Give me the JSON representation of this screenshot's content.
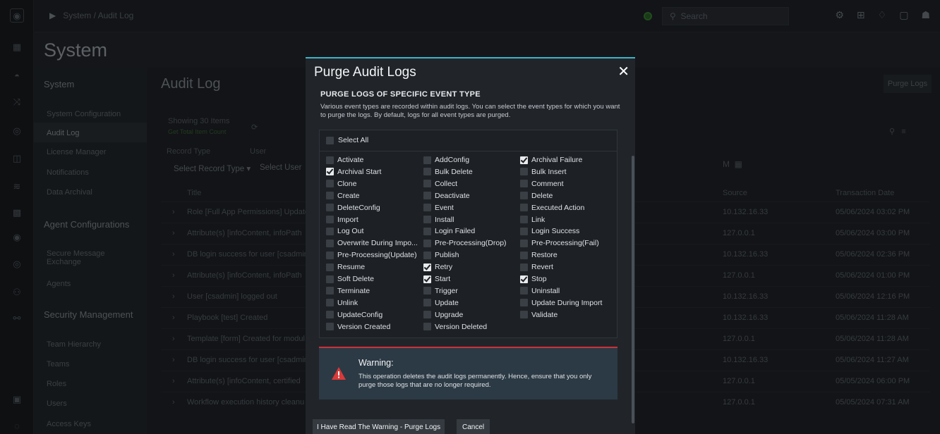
{
  "topbar": {
    "breadcrumb": "System / Audit Log",
    "search_placeholder": "Search"
  },
  "page": {
    "title": "System",
    "section_title": "Audit Log",
    "purge_button": "Purge Logs"
  },
  "leftnav": {
    "system_header": "System",
    "items": [
      "System Configuration",
      "Audit Log",
      "License Manager",
      "Notifications",
      "Data Archival"
    ],
    "agent_header": "Agent Configurations",
    "agent_items": [
      "Secure Message Exchange",
      "Agents"
    ],
    "security_header": "Security Management",
    "security_items": [
      "Team Hierarchy",
      "Teams",
      "Roles",
      "Users",
      "Access Keys"
    ]
  },
  "background": {
    "showing": "Showing 30 Items",
    "get_total": "Get Total Item Count",
    "record_type_label": "Record Type",
    "user_label": "User",
    "record_type_select": "Select Record Type",
    "user_select": "Select User",
    "col_title": "Title",
    "col_source": "Source",
    "col_date": "Transaction Date",
    "rows": [
      {
        "title": "Role [Full App Permissions] Update",
        "u": "in",
        "source": "10.132.16.33",
        "date": "05/06/2024 03:02 PM"
      },
      {
        "title": "Attribute(s) [infoContent, infoPath",
        "u": "k",
        "source": "127.0.0.1",
        "date": "05/06/2024 03:00 PM"
      },
      {
        "title": "DB login success for user [csadmin",
        "u": "in",
        "source": "10.132.16.33",
        "date": "05/06/2024 02:36 PM"
      },
      {
        "title": "Attribute(s) [infoContent, infoPath",
        "u": "k",
        "source": "127.0.0.1",
        "date": "05/06/2024 01:00 PM"
      },
      {
        "title": "User [csadmin] logged out",
        "u": "in",
        "source": "10.132.16.33",
        "date": "05/06/2024 12:16 PM"
      },
      {
        "title": "Playbook [test] Created",
        "u": "in",
        "source": "10.132.16.33",
        "date": "05/06/2024 11:28 AM"
      },
      {
        "title": "Template [form] Created for modul",
        "u": "in",
        "source": "127.0.0.1",
        "date": "05/06/2024 11:28 AM"
      },
      {
        "title": "DB login success for user [csadmin",
        "u": "in",
        "source": "10.132.16.33",
        "date": "05/06/2024 11:27 AM"
      },
      {
        "title": "Attribute(s) [infoContent, certified",
        "u": "k",
        "source": "127.0.0.1",
        "date": "05/05/2024 06:00 PM"
      },
      {
        "title": "Workflow execution history cleanu",
        "u": "k",
        "source": "127.0.0.1",
        "date": "05/05/2024 07:31 AM"
      }
    ]
  },
  "modal": {
    "title": "Purge Audit Logs",
    "close": "✕",
    "section_title": "PURGE LOGS OF SPECIFIC EVENT TYPE",
    "description": "Various event types are recorded within audit logs. You can select the event types for which you want to purge the logs. By default, logs for all event types are purged.",
    "select_all": "Select All",
    "event_types": [
      {
        "label": "Activate",
        "checked": false
      },
      {
        "label": "AddConfig",
        "checked": false
      },
      {
        "label": "Archival Failure",
        "checked": true
      },
      {
        "label": "Archival Start",
        "checked": true
      },
      {
        "label": "Bulk Delete",
        "checked": false
      },
      {
        "label": "Bulk Insert",
        "checked": false
      },
      {
        "label": "Clone",
        "checked": false
      },
      {
        "label": "Collect",
        "checked": false
      },
      {
        "label": "Comment",
        "checked": false
      },
      {
        "label": "Create",
        "checked": false
      },
      {
        "label": "Deactivate",
        "checked": false
      },
      {
        "label": "Delete",
        "checked": false
      },
      {
        "label": "DeleteConfig",
        "checked": false
      },
      {
        "label": "Event",
        "checked": false
      },
      {
        "label": "Executed Action",
        "checked": false
      },
      {
        "label": "Import",
        "checked": false
      },
      {
        "label": "Install",
        "checked": false
      },
      {
        "label": "Link",
        "checked": false
      },
      {
        "label": "Log Out",
        "checked": false
      },
      {
        "label": "Login Failed",
        "checked": false
      },
      {
        "label": "Login Success",
        "checked": false
      },
      {
        "label": "Overwrite During Impo...",
        "checked": false
      },
      {
        "label": "Pre-Processing(Drop)",
        "checked": false
      },
      {
        "label": "Pre-Processing(Fail)",
        "checked": false
      },
      {
        "label": "Pre-Processing(Update)",
        "checked": false
      },
      {
        "label": "Publish",
        "checked": false
      },
      {
        "label": "Restore",
        "checked": false
      },
      {
        "label": "Resume",
        "checked": false
      },
      {
        "label": "Retry",
        "checked": true
      },
      {
        "label": "Revert",
        "checked": false
      },
      {
        "label": "Soft Delete",
        "checked": false
      },
      {
        "label": "Start",
        "checked": true
      },
      {
        "label": "Stop",
        "checked": true
      },
      {
        "label": "Terminate",
        "checked": false
      },
      {
        "label": "Trigger",
        "checked": false
      },
      {
        "label": "Uninstall",
        "checked": false
      },
      {
        "label": "Unlink",
        "checked": false
      },
      {
        "label": "Update",
        "checked": false
      },
      {
        "label": "Update During Import",
        "checked": false
      },
      {
        "label": "UpdateConfig",
        "checked": false
      },
      {
        "label": "Upgrade",
        "checked": false
      },
      {
        "label": "Validate",
        "checked": false
      },
      {
        "label": "Version Created",
        "checked": false
      },
      {
        "label": "Version Deleted",
        "checked": false
      }
    ],
    "warning_title": "Warning:",
    "warning_text": "This operation deletes the audit logs permanently. Hence, ensure that you only purge those logs that are no longer required.",
    "confirm_button": "I Have Read The Warning - Purge Logs",
    "cancel_button": "Cancel"
  }
}
